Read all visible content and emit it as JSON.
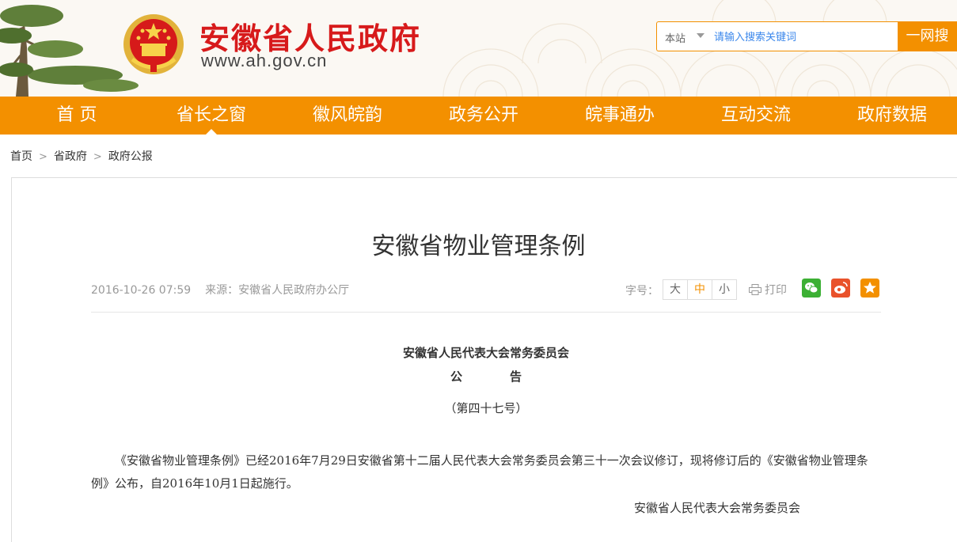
{
  "header": {
    "title": "安徽省人民政府",
    "url": "www.ah.gov.cn",
    "search": {
      "scope": "本站",
      "placeholder": "请输入搜索关键词",
      "button": "一网搜"
    }
  },
  "nav": [
    {
      "label": "首 页"
    },
    {
      "label": "省长之窗"
    },
    {
      "label": "徽风皖韵"
    },
    {
      "label": "政务公开"
    },
    {
      "label": "皖事通办"
    },
    {
      "label": "互动交流"
    },
    {
      "label": "政府数据"
    }
  ],
  "nav_active_index": 1,
  "breadcrumb": [
    "首页",
    "省政府",
    "政府公报"
  ],
  "article": {
    "title": "安徽省物业管理条例",
    "datetime": "2016-10-26 07:59",
    "source": "来源：安徽省人民政府办公厅",
    "font_size_label": "字号：",
    "font_sizes": [
      "大",
      "中",
      "小"
    ],
    "font_size_selected": "中",
    "print_label": "打印",
    "share_icons": [
      "wechat-icon",
      "weibo-icon",
      "favorite-star-icon"
    ],
    "body": {
      "org": "安徽省人民代表大会常务委员会",
      "notice_chars": [
        "公",
        "告"
      ],
      "number": "（第四十七号）",
      "paragraph": "《安徽省物业管理条例》已经2016年7月29日安徽省第十二届人民代表大会常务委员会第三十一次会议修订，现将修订后的《安徽省物业管理条例》公布，自2016年10月1日起施行。",
      "signature": "安徽省人民代表大会常务委员会"
    }
  },
  "colors": {
    "brand_orange": "#f39000",
    "title_red": "#d71a1b",
    "wechat_green": "#3cb034",
    "weibo_orange": "#e9522b",
    "star_orange": "#f39000"
  }
}
